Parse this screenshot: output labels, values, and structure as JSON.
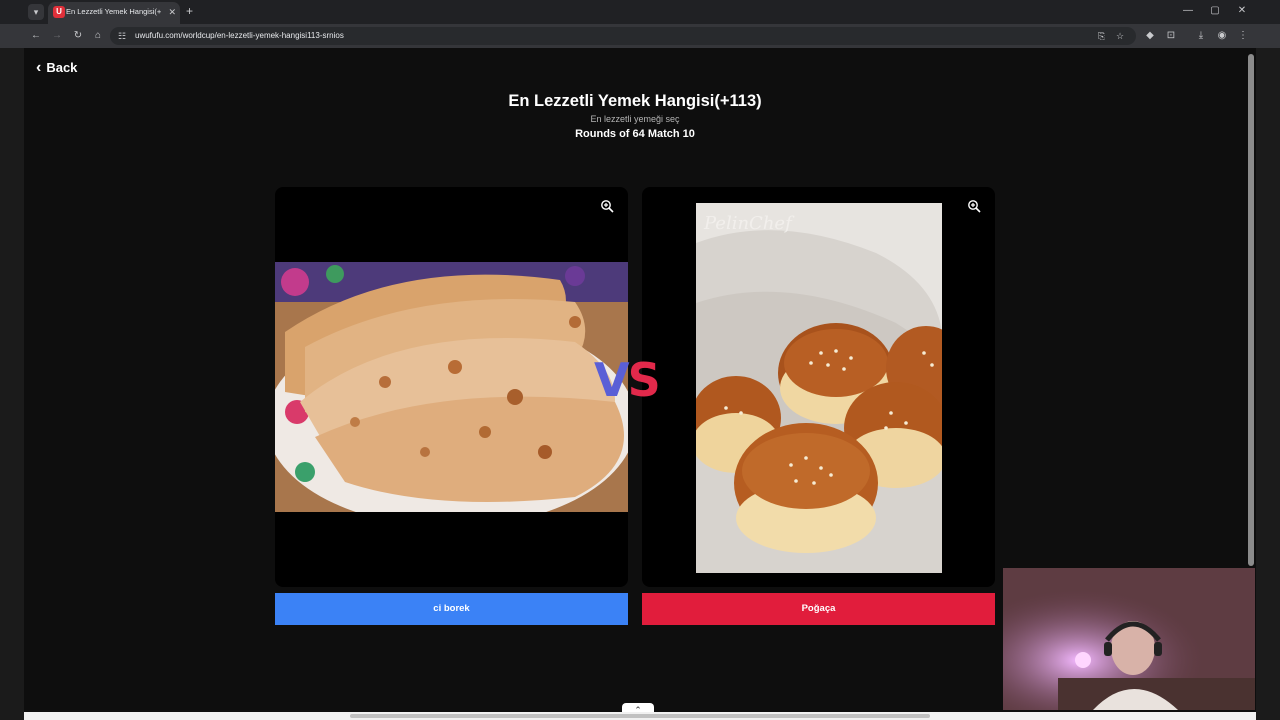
{
  "browser": {
    "tab_title": "En Lezzetli Yemek Hangisi(+113)",
    "tab_favicon_letter": "U",
    "url": "uwufufu.com/worldcup/en-lezzetli-yemek-hangisi113-srnios",
    "accent": "#e0303a"
  },
  "page": {
    "back_label": "Back",
    "title": "En Lezzetli Yemek Hangisi(+113)",
    "subtitle": "En lezzetli yemeği seç",
    "round_label": "Rounds of 64 Match 10",
    "vs_v": "V",
    "vs_s": "S"
  },
  "left_choice": {
    "label": "ci borek",
    "button_color": "#3b82f6",
    "image_icon": "cheburek-photo"
  },
  "right_choice": {
    "label": "Poğaça",
    "button_color": "#e11d3c",
    "image_icon": "pogaca-photo",
    "watermark": "PelinChef"
  },
  "icons": {
    "zoom": "zoom-in-icon",
    "back": "chevron-left-icon"
  }
}
